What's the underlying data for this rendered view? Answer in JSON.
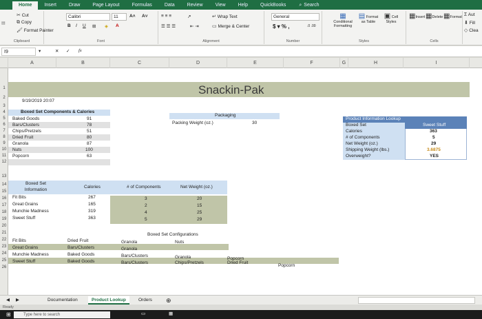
{
  "ribbon_tabs": [
    "Home",
    "Insert",
    "Draw",
    "Page Layout",
    "Formulas",
    "Data",
    "Review",
    "View",
    "Help",
    "QuickBooks"
  ],
  "search_label": "Search",
  "clipboard": {
    "cut": "Cut",
    "copy": "Copy",
    "format_painter": "Format Painter",
    "label": "Clipboard"
  },
  "font": {
    "name": "Calibri",
    "size": "11",
    "label": "Font"
  },
  "alignment": {
    "wrap": "Wrap Text",
    "merge": "Merge & Center",
    "label": "Alignment"
  },
  "number": {
    "format": "General",
    "label": "Number"
  },
  "styles": {
    "conditional": "Conditional Formatting",
    "format_table": "Format as Table",
    "cell_styles": "Cell Styles",
    "label": "Styles"
  },
  "cells": {
    "insert": "Insert",
    "delete": "Delete",
    "format": "Format",
    "label": "Cells"
  },
  "editing": {
    "autosum": "Aut",
    "fill": "Fill",
    "clear": "Clea"
  },
  "formula_bar": {
    "name_box": "I9",
    "fx": "fx",
    "value": ""
  },
  "columns": [
    "A",
    "B",
    "C",
    "D",
    "E",
    "F",
    "G",
    "H",
    "I"
  ],
  "rows": [
    "1",
    "2",
    "3",
    "4",
    "5",
    "6",
    "7",
    "8",
    "9",
    "10",
    "11",
    "12",
    "13",
    "14",
    "15",
    "16",
    "17",
    "18",
    "19",
    "20",
    "21",
    "22",
    "23",
    "24",
    "25",
    "26"
  ],
  "title": "Snackin-Pak",
  "date": "9/19/2019 20:07",
  "components": {
    "header": "Boxed Set Components & Calories",
    "items": [
      {
        "name": "Baked Goods",
        "cal": "91"
      },
      {
        "name": "Bars/Clusters",
        "cal": "78"
      },
      {
        "name": "Chips/Pretzels",
        "cal": "51"
      },
      {
        "name": "Dried Fruit",
        "cal": "80"
      },
      {
        "name": "Granola",
        "cal": "87"
      },
      {
        "name": "Nuts",
        "cal": "100"
      },
      {
        "name": "Popcorn",
        "cal": "63"
      }
    ]
  },
  "packaging": {
    "header": "Packaging",
    "label": "Packing Weight (oz.)",
    "value": "30"
  },
  "lookup": {
    "header": "Product Information Lookup",
    "labels": [
      "Boxed Set",
      "Calories",
      "# of Components",
      "Net Weight (oz.)",
      "Shipping Weight (lbs.)",
      "Overweight?"
    ],
    "values": [
      "Sweet Stuff",
      "363",
      "5",
      "29",
      "3.6875",
      "YES"
    ]
  },
  "info_table": {
    "headers": [
      "Boxed Set Information",
      "Calories",
      "# of Components",
      "Net Weight (oz.)"
    ],
    "rows": [
      {
        "name": "Fit Bits",
        "cal": "267",
        "comp": "3",
        "weight": "20"
      },
      {
        "name": "Great Grains",
        "cal": "165",
        "comp": "2",
        "weight": "15"
      },
      {
        "name": "Munchie Madness",
        "cal": "319",
        "comp": "4",
        "weight": "25"
      },
      {
        "name": "Sweet Stuff",
        "cal": "363",
        "comp": "5",
        "weight": "29"
      }
    ]
  },
  "configurations": {
    "header": "Boxed Set Configurations",
    "rows": [
      {
        "name": "Fit Bits",
        "c1": "Dried Fruit",
        "c2": "Granola",
        "c3": "Nuts",
        "c4": "",
        "c5": ""
      },
      {
        "name": "Great Grains",
        "c1": "Bars/Clusters",
        "c2": "Granola",
        "c3": "",
        "c4": "",
        "c5": ""
      },
      {
        "name": "Munchie Madness",
        "c1": "Baked Goods",
        "c2": "Bars/Clusters",
        "c3": "Granola",
        "c4": "Popcorn",
        "c5": ""
      },
      {
        "name": "Sweet Stuff",
        "c1": "Baked Goods",
        "c2": "Bars/Clusters",
        "c3": "Chips/Pretzels",
        "c4": "Dried Fruit",
        "c5": "Popcorn"
      }
    ]
  },
  "sheet_tabs": [
    "Documentation",
    "Product Lookup",
    "Orders"
  ],
  "status": "Ready",
  "taskbar_search": "Type here to search",
  "colors": {
    "ribbon": "#1f6e43",
    "header_blue": "#cfe0f2",
    "dark_blue": "#5b82b8",
    "olive": "#c0c5a8",
    "gold": "#c58a1a"
  }
}
